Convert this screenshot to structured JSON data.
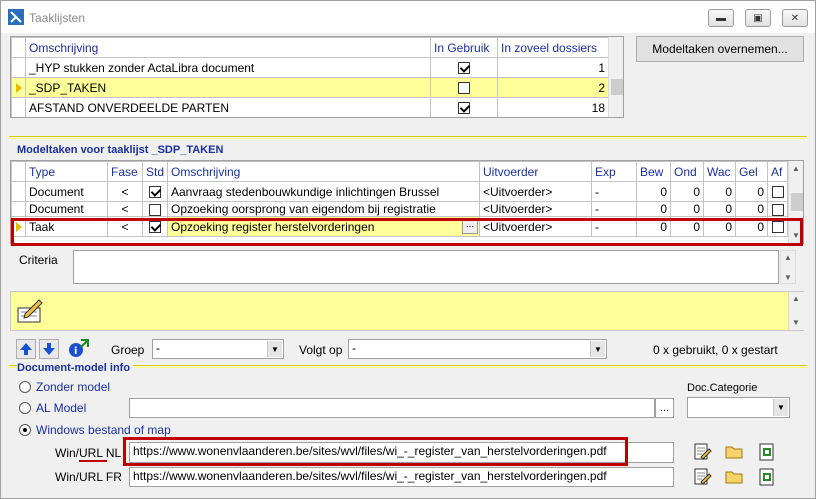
{
  "window": {
    "title": "Taaklijsten"
  },
  "tasklists": {
    "headers": {
      "omschrijving": "Omschrijving",
      "in_gebruik": "In Gebruik",
      "dossiers": "In zoveel dossiers"
    },
    "rows": [
      {
        "omschrijving": "_HYP stukken zonder ActaLibra document",
        "in_gebruik": true,
        "dossiers": "1",
        "selected": false
      },
      {
        "omschrijving": "_SDP_TAKEN",
        "in_gebruik": false,
        "dossiers": "2",
        "selected": true
      },
      {
        "omschrijving": "AFSTAND ONVERDEELDE PARTEN",
        "in_gebruik": true,
        "dossiers": "18",
        "selected": false
      }
    ]
  },
  "modeltaken_button": "Modeltaken overnemen...",
  "modeltaken": {
    "section_title": "Modeltaken voor taaklijst _SDP_TAKEN",
    "headers": {
      "type": "Type",
      "fase": "Fase",
      "std": "Std",
      "omschrijving": "Omschrijving",
      "uitvoerder": "Uitvoerder",
      "exp": "Exp",
      "bew": "Bew",
      "ond": "Ond",
      "wac": "Wac",
      "gel": "Gel",
      "af": "Af"
    },
    "rows": [
      {
        "type": "Document",
        "fase": "<",
        "std": true,
        "omschrijving": "Aanvraag stedenbouwkundige inlichtingen Brussel",
        "uitvoerder": "<Uitvoerder>",
        "exp": "-",
        "bew": "0",
        "ond": "0",
        "wac": "0",
        "gel": "0",
        "af": false
      },
      {
        "type": "Document",
        "fase": "<",
        "std": false,
        "omschrijving": "Opzoeking oorsprong van eigendom bij registratie",
        "uitvoerder": "<Uitvoerder>",
        "exp": "-",
        "bew": "0",
        "ond": "0",
        "wac": "0",
        "gel": "0",
        "af": false
      },
      {
        "type": "Taak",
        "fase": "<",
        "std": true,
        "omschrijving": "Opzoeking register herstelvorderingen",
        "uitvoerder": "<Uitvoerder>",
        "exp": "-",
        "bew": "0",
        "ond": "0",
        "wac": "0",
        "gel": "0",
        "af": false
      }
    ],
    "ellipsis": "..."
  },
  "criteria": {
    "label": "Criteria",
    "value": ""
  },
  "nav": {
    "groep_label": "Groep",
    "groep_value": "-",
    "volgt_op_label": "Volgt op",
    "volgt_op_value": "-",
    "usage": "0 x gebruikt, 0 x gestart"
  },
  "docmodel": {
    "section_title": "Document-model info",
    "options": {
      "zonder": "Zonder model",
      "al": "AL Model",
      "windows": "Windows bestand of map"
    },
    "selected": "windows",
    "al_model_value": "",
    "al_ellipsis": "...",
    "doc_categorie_label": "Doc.Categorie",
    "doc_categorie_value": "",
    "url_nl_label": "Win/URL NL",
    "url_nl": "https://www.wonenvlaanderen.be/sites/wvl/files/wi_-_register_van_herstelvorderingen.pdf",
    "url_fr_label": "Win/URL FR",
    "url_fr": "https://www.wonenvlaanderen.be/sites/wvl/files/wi_-_register_van_herstelvorderingen.pdf"
  },
  "colors": {
    "selection": "#ffff99",
    "header_text": "#1a2fa0",
    "highlight_box": "#c00000",
    "panel_yellow": "#ffff99"
  }
}
